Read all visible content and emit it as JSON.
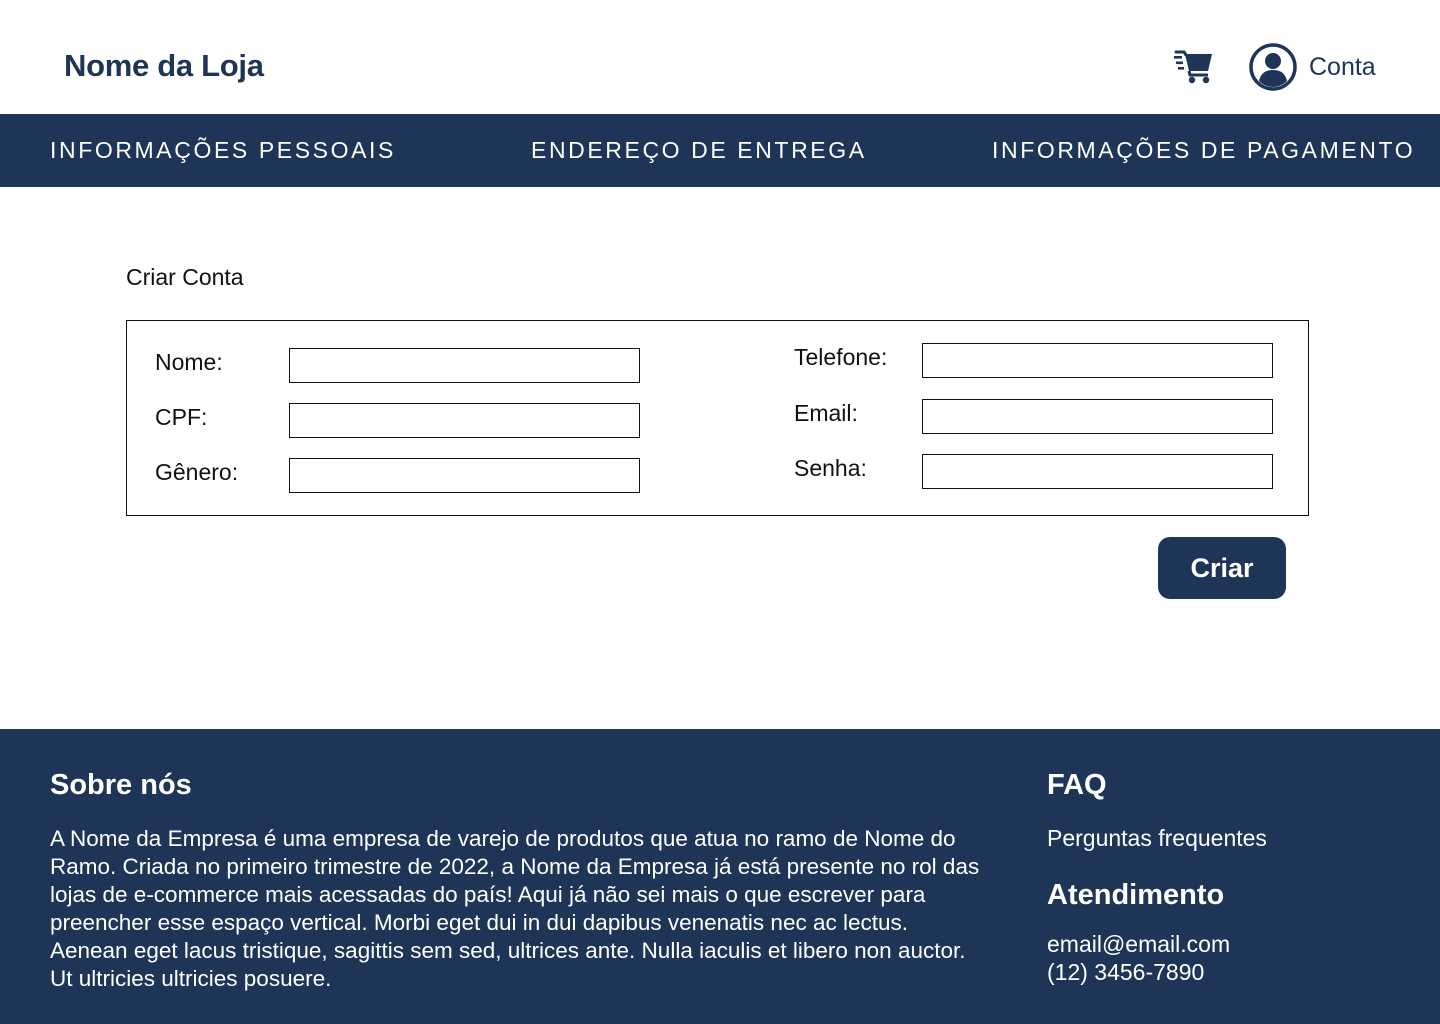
{
  "header": {
    "store_name": "Nome da Loja",
    "cart_icon": "shopping-cart-icon",
    "account_icon": "user-circle-icon",
    "account_label": "Conta"
  },
  "nav": {
    "tabs": [
      {
        "label": "INFORMAÇÕES PESSOAIS"
      },
      {
        "label": "ENDEREÇO DE ENTREGA"
      },
      {
        "label": "INFORMAÇÕES DE PAGAMENTO"
      }
    ]
  },
  "form": {
    "title": "Criar Conta",
    "left_fields": [
      {
        "label": "Nome:",
        "value": ""
      },
      {
        "label": "CPF:",
        "value": ""
      },
      {
        "label": "Gênero:",
        "value": ""
      }
    ],
    "right_fields": [
      {
        "label": "Telefone:",
        "value": ""
      },
      {
        "label": "Email:",
        "value": ""
      },
      {
        "label": "Senha:",
        "value": ""
      }
    ],
    "submit_label": "Criar"
  },
  "footer": {
    "about_title": "Sobre nós",
    "about_text": "A Nome da Empresa é uma empresa de varejo de produtos que atua no ramo de Nome do Ramo. Criada no primeiro trimestre de 2022, a Nome da Empresa já está presente no rol das  lojas de e-commerce mais acessadas do país! Aqui já não sei mais o que escrever para preencher esse espaço vertical. Morbi eget dui in dui dapibus venenatis nec ac lectus. Aenean eget lacus tristique, sagittis sem sed, ultrices ante. Nulla iaculis et libero non auctor. Ut ultricies ultricies posuere.",
    "faq_title": "FAQ",
    "faq_link": "Perguntas frequentes",
    "support_title": "Atendimento",
    "support_email": "email@email.com",
    "support_phone": "(12) 3456-7890"
  },
  "colors": {
    "brand_navy": "#1e3557",
    "white": "#ffffff"
  }
}
